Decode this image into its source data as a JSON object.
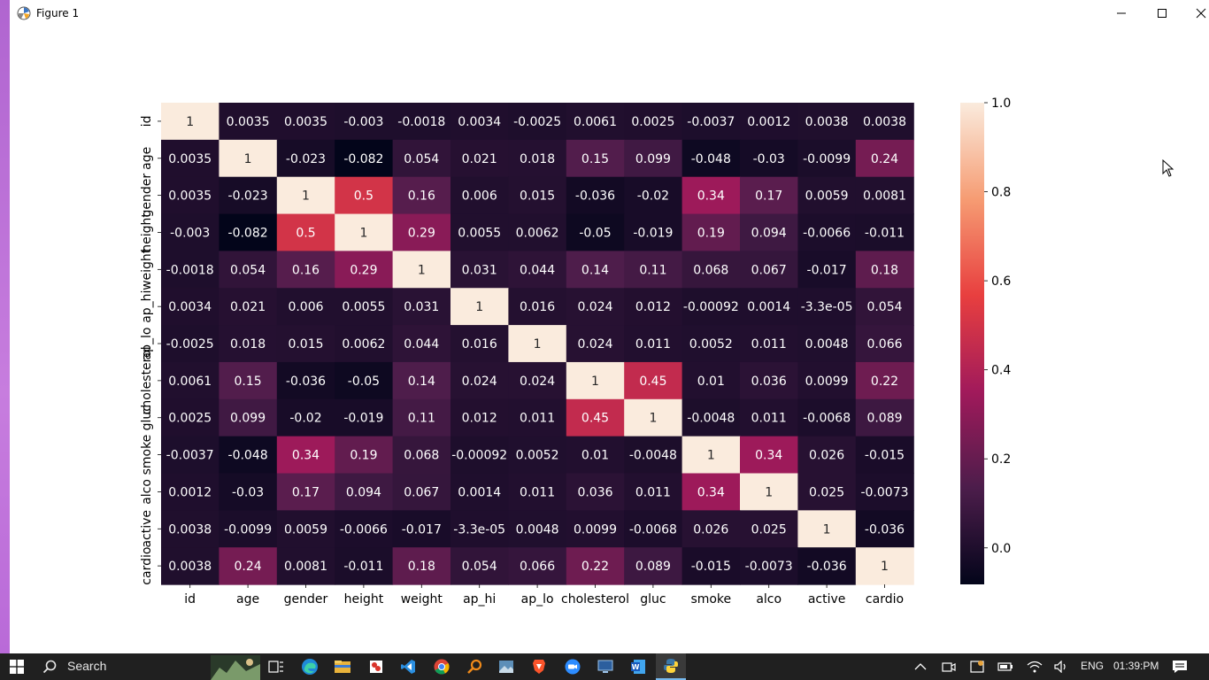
{
  "window": {
    "title": "Figure 1"
  },
  "colors": {
    "cmap": [
      "#03051a",
      "#4c1d4b",
      "#a11a5b",
      "#e83f3f",
      "#f69c73",
      "#faebdd"
    ]
  },
  "chart_data": {
    "type": "heatmap",
    "labels": [
      "id",
      "age",
      "gender",
      "height",
      "weight",
      "ap_hi",
      "ap_lo",
      "cholesterol",
      "gluc",
      "smoke",
      "alco",
      "active",
      "cardio"
    ],
    "matrix": [
      [
        1,
        0.0035,
        0.0035,
        -0.003,
        -0.0018,
        0.0034,
        -0.0025,
        0.0061,
        0.0025,
        -0.0037,
        0.0012,
        0.0038,
        0.0038
      ],
      [
        0.0035,
        1,
        -0.023,
        -0.082,
        0.054,
        0.021,
        0.018,
        0.15,
        0.099,
        -0.048,
        -0.03,
        -0.0099,
        0.24
      ],
      [
        0.0035,
        -0.023,
        1,
        0.5,
        0.16,
        0.006,
        0.015,
        -0.036,
        -0.02,
        0.34,
        0.17,
        0.0059,
        0.0081
      ],
      [
        -0.003,
        -0.082,
        0.5,
        1,
        0.29,
        0.0055,
        0.0062,
        -0.05,
        -0.019,
        0.19,
        0.094,
        -0.0066,
        -0.011
      ],
      [
        -0.0018,
        0.054,
        0.16,
        0.29,
        1,
        0.031,
        0.044,
        0.14,
        0.11,
        0.068,
        0.067,
        -0.017,
        0.18
      ],
      [
        0.0034,
        0.021,
        0.006,
        0.0055,
        0.031,
        1,
        0.016,
        0.024,
        0.012,
        -0.00092,
        0.0014,
        -3.3e-05,
        0.054
      ],
      [
        -0.0025,
        0.018,
        0.015,
        0.0062,
        0.044,
        0.016,
        1,
        0.024,
        0.011,
        0.0052,
        0.011,
        0.0048,
        0.066
      ],
      [
        0.0061,
        0.15,
        -0.036,
        -0.05,
        0.14,
        0.024,
        0.024,
        1,
        0.45,
        0.01,
        0.036,
        0.0099,
        0.22
      ],
      [
        0.0025,
        0.099,
        -0.02,
        -0.019,
        0.11,
        0.012,
        0.011,
        0.45,
        1,
        -0.0048,
        0.011,
        -0.0068,
        0.089
      ],
      [
        -0.0037,
        -0.048,
        0.34,
        0.19,
        0.068,
        -0.00092,
        0.0052,
        0.01,
        -0.0048,
        1,
        0.34,
        0.026,
        -0.015
      ],
      [
        0.0012,
        -0.03,
        0.17,
        0.094,
        0.067,
        0.0014,
        0.011,
        0.036,
        0.011,
        0.34,
        1,
        0.025,
        -0.0073
      ],
      [
        0.0038,
        -0.0099,
        0.0059,
        -0.0066,
        -0.017,
        -3.3e-05,
        0.0048,
        0.0099,
        -0.0068,
        0.026,
        0.025,
        1,
        -0.036
      ],
      [
        0.0038,
        0.24,
        0.0081,
        -0.011,
        0.18,
        0.054,
        0.066,
        0.22,
        0.089,
        -0.015,
        -0.0073,
        -0.036,
        1
      ]
    ],
    "annotations": [
      [
        "1",
        "0.0035",
        "0.0035",
        "-0.003",
        "-0.0018",
        "0.0034",
        "-0.0025",
        "0.0061",
        "0.0025",
        "-0.0037",
        "0.0012",
        "0.0038",
        "0.0038"
      ],
      [
        "0.0035",
        "1",
        "-0.023",
        "-0.082",
        "0.054",
        "0.021",
        "0.018",
        "0.15",
        "0.099",
        "-0.048",
        "-0.03",
        "-0.0099",
        "0.24"
      ],
      [
        "0.0035",
        "-0.023",
        "1",
        "0.5",
        "0.16",
        "0.006",
        "0.015",
        "-0.036",
        "-0.02",
        "0.34",
        "0.17",
        "0.0059",
        "0.0081"
      ],
      [
        "-0.003",
        "-0.082",
        "0.5",
        "1",
        "0.29",
        "0.0055",
        "0.0062",
        "-0.05",
        "-0.019",
        "0.19",
        "0.094",
        "-0.0066",
        "-0.011"
      ],
      [
        "-0.0018",
        "0.054",
        "0.16",
        "0.29",
        "1",
        "0.031",
        "0.044",
        "0.14",
        "0.11",
        "0.068",
        "0.067",
        "-0.017",
        "0.18"
      ],
      [
        "0.0034",
        "0.021",
        "0.006",
        "0.0055",
        "0.031",
        "1",
        "0.016",
        "0.024",
        "0.012",
        "-0.00092",
        "0.0014",
        "-3.3e-05",
        "0.054"
      ],
      [
        "-0.0025",
        "0.018",
        "0.015",
        "0.0062",
        "0.044",
        "0.016",
        "1",
        "0.024",
        "0.011",
        "0.0052",
        "0.011",
        "0.0048",
        "0.066"
      ],
      [
        "0.0061",
        "0.15",
        "-0.036",
        "-0.05",
        "0.14",
        "0.024",
        "0.024",
        "1",
        "0.45",
        "0.01",
        "0.036",
        "0.0099",
        "0.22"
      ],
      [
        "0.0025",
        "0.099",
        "-0.02",
        "-0.019",
        "0.11",
        "0.012",
        "0.011",
        "0.45",
        "1",
        "-0.0048",
        "0.011",
        "-0.0068",
        "0.089"
      ],
      [
        "-0.0037",
        "-0.048",
        "0.34",
        "0.19",
        "0.068",
        "-0.00092",
        "0.0052",
        "0.01",
        "-0.0048",
        "1",
        "0.34",
        "0.026",
        "-0.015"
      ],
      [
        "0.0012",
        "-0.03",
        "0.17",
        "0.094",
        "0.067",
        "0.0014",
        "0.011",
        "0.036",
        "0.011",
        "0.34",
        "1",
        "0.025",
        "-0.0073"
      ],
      [
        "0.0038",
        "-0.0099",
        "0.0059",
        "-0.0066",
        "-0.017",
        "-3.3e-05",
        "0.0048",
        "0.0099",
        "-0.0068",
        "0.026",
        "0.025",
        "1",
        "-0.036"
      ],
      [
        "0.0038",
        "0.24",
        "0.0081",
        "-0.011",
        "0.18",
        "0.054",
        "0.066",
        "0.22",
        "0.089",
        "-0.015",
        "-0.0073",
        "-0.036",
        "1"
      ]
    ],
    "vmin": -0.082,
    "vmax": 1.0,
    "colorbar_ticks": [
      0.0,
      0.2,
      0.4,
      0.6,
      0.8,
      1.0
    ],
    "colorbar_tick_labels": [
      "0.0",
      "0.2",
      "0.4",
      "0.6",
      "0.8",
      "1.0"
    ]
  },
  "taskbar": {
    "search_label": "Search",
    "icons": [
      "windows-start-icon",
      "search-icon",
      "task-view-icon",
      "edge-icon",
      "file-explorer-icon",
      "app-icon",
      "vscode-icon",
      "chrome-icon",
      "search-app-icon",
      "image-viewer-icon",
      "brave-icon",
      "zoom-icon",
      "remote-desktop-icon",
      "word-icon",
      "python-icon"
    ],
    "language": "ENG",
    "time": "01:39:PM"
  }
}
